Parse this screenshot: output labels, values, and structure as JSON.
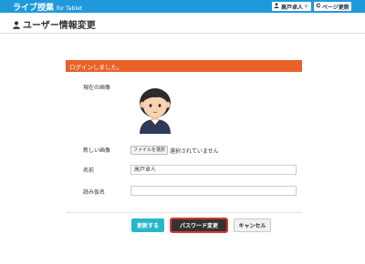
{
  "header": {
    "app_title": "ライブ授業",
    "app_subtitle": "for Tablet",
    "user_name": "高戸卓人",
    "user_chevron": "v",
    "reload_label": "ページ更新",
    "icons": {
      "user": "user-icon",
      "reload": "reload-icon",
      "chevron": "chevron-down-icon"
    },
    "colors": {
      "bar": "#1e9adb"
    }
  },
  "page": {
    "title": "ユーザー情報変更",
    "title_icon": "person-icon"
  },
  "alert": {
    "message": "ログインしました。",
    "color": "#e8622a"
  },
  "form": {
    "current_image_label": "現在の画像",
    "new_image_label": "新しい画像",
    "file_button_label": "ファイルを選択",
    "file_status": "選択されていません",
    "name_label": "名前",
    "name_value": "高戸卓人",
    "reading_label": "読み仮名",
    "reading_value": ""
  },
  "actions": {
    "update_label": "更新する",
    "password_label": "パスワード変更",
    "cancel_label": "キャンセル",
    "colors": {
      "update": "#27b7c8",
      "password": "#333333",
      "password_border": "#d33a2c"
    }
  }
}
